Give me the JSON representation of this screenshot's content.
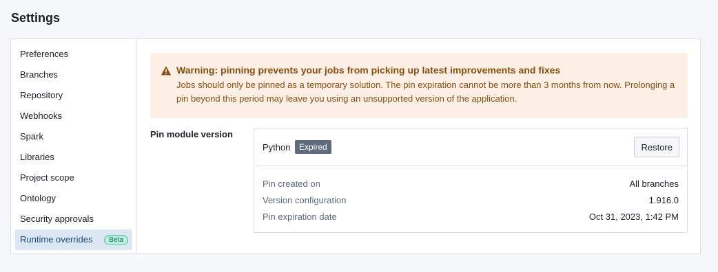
{
  "page": {
    "title": "Settings"
  },
  "sidebar": {
    "items": [
      {
        "label": "Preferences"
      },
      {
        "label": "Branches"
      },
      {
        "label": "Repository"
      },
      {
        "label": "Webhooks"
      },
      {
        "label": "Spark"
      },
      {
        "label": "Libraries"
      },
      {
        "label": "Project scope"
      },
      {
        "label": "Ontology"
      },
      {
        "label": "Security approvals"
      },
      {
        "label": "Runtime overrides",
        "badge": "Beta",
        "active": true
      }
    ]
  },
  "warning": {
    "icon": "warning-triangle-icon",
    "title": "Warning: pinning prevents your jobs from picking up latest improvements and fixes",
    "body": "Jobs should only be pinned as a temporary solution. The pin expiration cannot be more than 3 months from now. Prolonging a pin beyond this period may leave you using an unsupported version of the application.",
    "color": "#8a4f10",
    "background": "#fbefe6"
  },
  "pin_module": {
    "label": "Pin module version",
    "module_name": "Python",
    "status_tag": "Expired",
    "restore_label": "Restore",
    "details": [
      {
        "key": "Pin created on",
        "value": "All branches"
      },
      {
        "key": "Version configuration",
        "value": "1.916.0"
      },
      {
        "key": "Pin expiration date",
        "value": "Oct 31, 2023, 1:42 PM"
      }
    ]
  }
}
